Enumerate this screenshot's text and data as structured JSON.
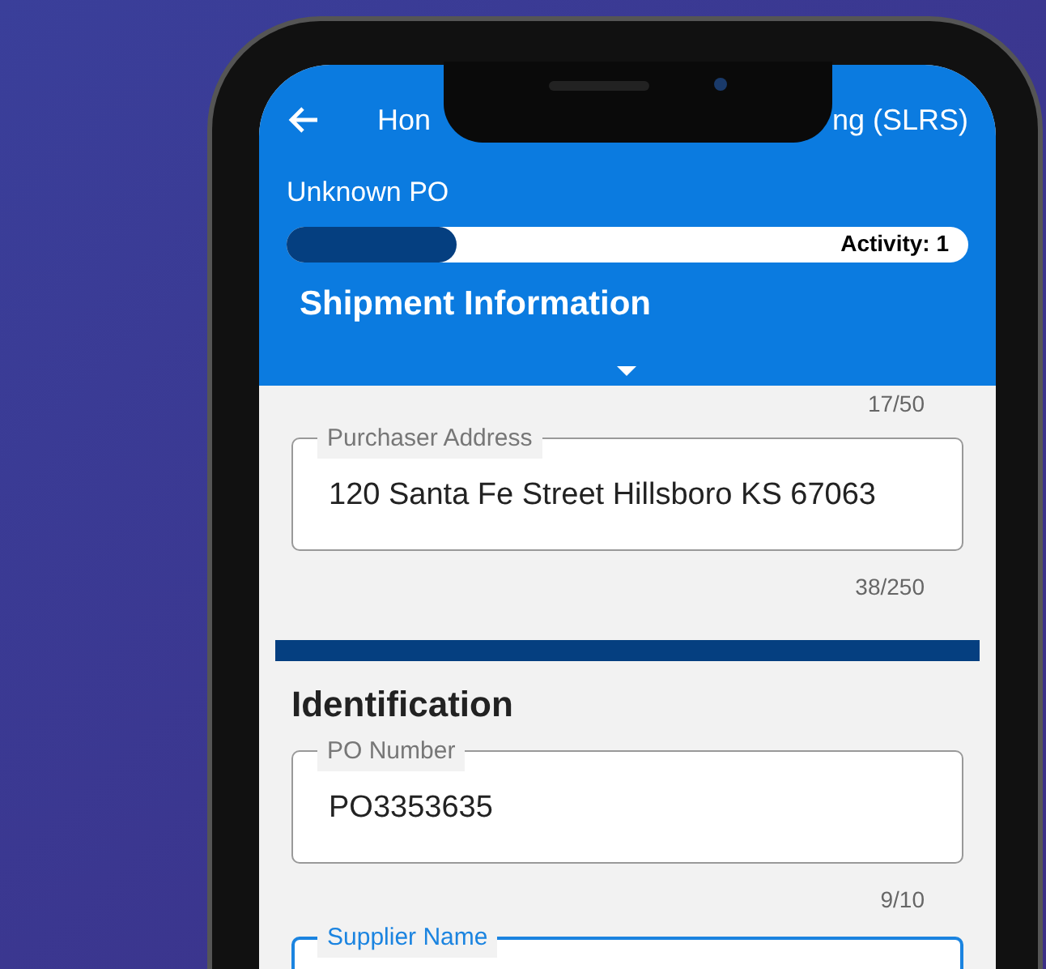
{
  "header": {
    "title_start": "Hon",
    "title_end": "ng (SLRS)",
    "subtitle": "Unknown PO",
    "progress": {
      "level": 0.25,
      "label": "Activity: 1"
    },
    "section": "Shipment Information"
  },
  "fields": [
    {
      "kind": "counter",
      "counter": "17/50"
    },
    {
      "kind": "field",
      "label": "Purchaser Address",
      "value": "120 Santa Fe Street Hillsboro KS 67063",
      "counter": "38/250",
      "focused": false
    },
    {
      "kind": "heading",
      "text": "Identification"
    },
    {
      "kind": "field",
      "label": "PO Number",
      "value": "PO3353635",
      "counter": "9/10",
      "focused": false
    },
    {
      "kind": "field",
      "label": "Supplier Name",
      "focused": true
    }
  ]
}
